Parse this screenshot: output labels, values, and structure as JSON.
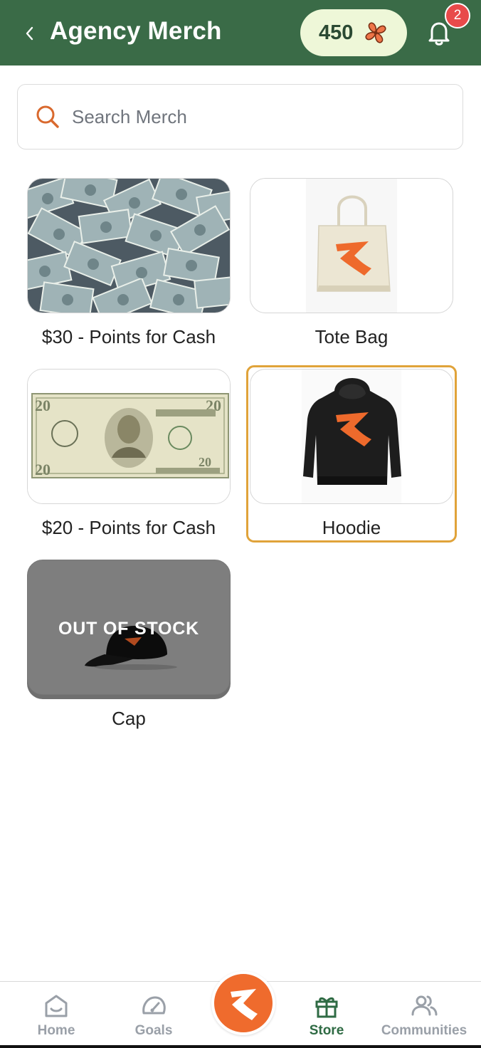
{
  "header": {
    "title": "Agency Merch",
    "points": "450",
    "notification_count": "2",
    "color": "#3a6b47"
  },
  "search": {
    "placeholder": "Search Merch"
  },
  "products": [
    {
      "name": "$30 - Points for Cash",
      "image": "cash-pile-image",
      "out_of_stock": false
    },
    {
      "name": "Tote Bag",
      "image": "tote-bag-image",
      "out_of_stock": false
    },
    {
      "name": "$20 - Points for Cash",
      "image": "twenty-dollar-bill-image",
      "out_of_stock": false
    },
    {
      "name": "Hoodie",
      "image": "hoodie-image",
      "out_of_stock": false,
      "selected": true
    },
    {
      "name": "Cap",
      "image": "cap-image",
      "out_of_stock": true,
      "badge": "OUT OF STOCK"
    }
  ],
  "nav": {
    "items": [
      {
        "label": "Home",
        "icon": "home-icon"
      },
      {
        "label": "Goals",
        "icon": "gauge-icon"
      },
      {
        "label": "Store",
        "icon": "gift-icon",
        "active": true
      },
      {
        "label": "Communities",
        "icon": "people-icon"
      }
    ],
    "center": "brand-logo-icon",
    "accent": "#ef6b2d",
    "active_color": "#2f6b44"
  }
}
